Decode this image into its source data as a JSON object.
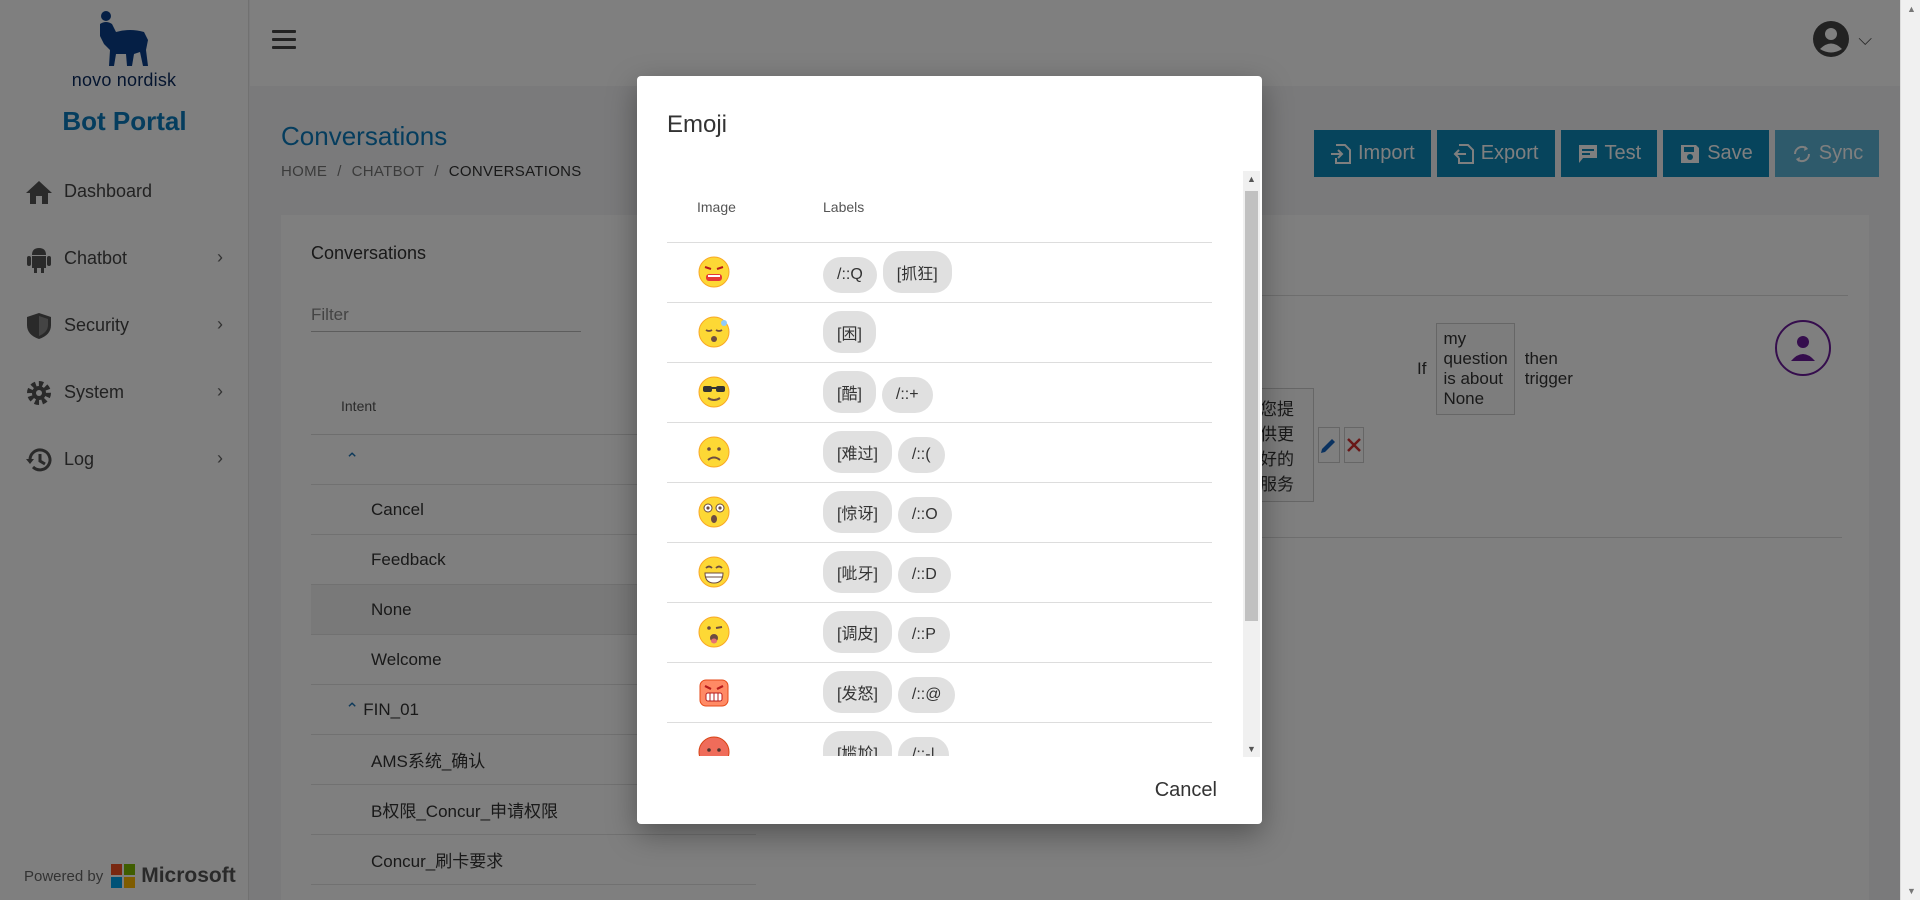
{
  "sidebar": {
    "logo_text": "novo nordisk",
    "portal_title": "Bot Portal",
    "items": [
      {
        "label": "Dashboard",
        "icon": "home-icon",
        "has_children": false
      },
      {
        "label": "Chatbot",
        "icon": "android-icon",
        "has_children": true
      },
      {
        "label": "Security",
        "icon": "shield-icon",
        "has_children": true
      },
      {
        "label": "System",
        "icon": "gear-icon",
        "has_children": true
      },
      {
        "label": "Log",
        "icon": "history-icon",
        "has_children": true
      }
    ],
    "powered_by": "Powered by",
    "brand": "Microsoft"
  },
  "page": {
    "title": "Conversations",
    "breadcrumb": [
      "HOME",
      "CHATBOT",
      "CONVERSATIONS"
    ],
    "actions": [
      {
        "label": "Import",
        "icon": "import-icon",
        "disabled": false
      },
      {
        "label": "Export",
        "icon": "export-icon",
        "disabled": false
      },
      {
        "label": "Test",
        "icon": "chat-icon",
        "disabled": false
      },
      {
        "label": "Save",
        "icon": "save-icon",
        "disabled": false
      },
      {
        "label": "Sync",
        "icon": "sync-icon",
        "disabled": true
      }
    ]
  },
  "conversations": {
    "heading": "Conversations",
    "filter_placeholder": "Filter",
    "column_intent": "Intent",
    "tree": [
      {
        "type": "group",
        "name": ""
      },
      {
        "type": "leaf",
        "name": "Cancel"
      },
      {
        "type": "leaf",
        "name": "Feedback"
      },
      {
        "type": "leaf",
        "name": "None",
        "selected": true
      },
      {
        "type": "leaf",
        "name": "Welcome"
      },
      {
        "type": "group",
        "name": "FIN_01"
      },
      {
        "type": "leaf",
        "name": "AMS系统_确认"
      },
      {
        "type": "leaf",
        "name": "B权限_Concur_申请权限"
      },
      {
        "type": "leaf",
        "name": "Concur_刷卡要求"
      }
    ]
  },
  "rule": {
    "if": "If",
    "condition": "my question is about None",
    "then": "then trigger",
    "response_text": "您提供更好的服务"
  },
  "dialog": {
    "title": "Emoji",
    "col_image": "Image",
    "col_labels": "Labels",
    "rows": [
      {
        "face": "grimace",
        "labels": [
          "/::Q",
          "[抓狂]"
        ]
      },
      {
        "face": "sleepy",
        "labels": [
          "[困]"
        ]
      },
      {
        "face": "cool",
        "labels": [
          "[酷]",
          "/::+"
        ]
      },
      {
        "face": "sad",
        "labels": [
          "[难过]",
          "/::("
        ]
      },
      {
        "face": "surprised",
        "labels": [
          "[惊讶]",
          "/::O"
        ]
      },
      {
        "face": "grin",
        "labels": [
          "[呲牙]",
          "/::D"
        ]
      },
      {
        "face": "tongue",
        "labels": [
          "[调皮]",
          "/::P"
        ]
      },
      {
        "face": "angry",
        "labels": [
          "[发怒]",
          "/::@"
        ]
      },
      {
        "face": "awkward",
        "labels": [
          "[尴尬]",
          "/::-|"
        ]
      }
    ],
    "cancel_label": "Cancel"
  },
  "colors": {
    "accent": "#0b7bbd",
    "button": "#0d88b8",
    "button_disabled": "#5cb4d6",
    "emoji_yellow": "#fdd835"
  }
}
